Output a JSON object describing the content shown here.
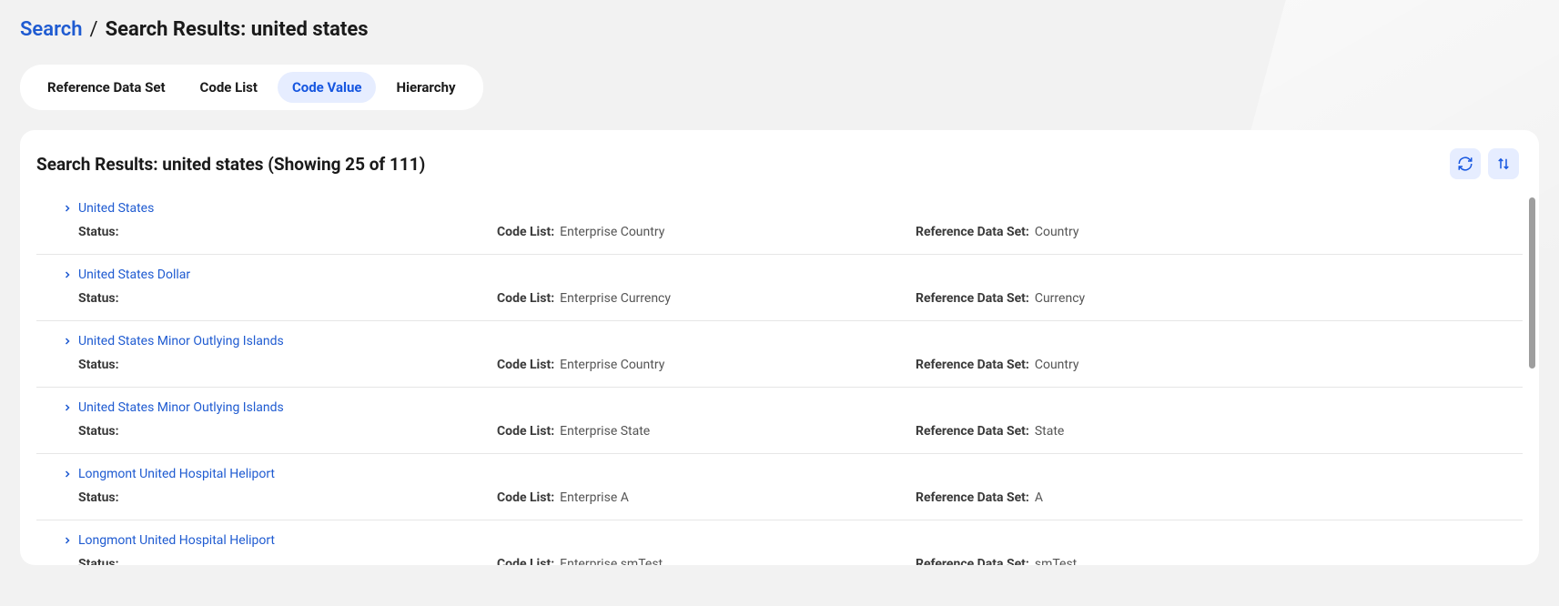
{
  "breadcrumb": {
    "root": "Search",
    "separator": "/",
    "current": "Search Results: united states"
  },
  "tabs": [
    {
      "label": "Reference Data Set",
      "active": false
    },
    {
      "label": "Code List",
      "active": false
    },
    {
      "label": "Code Value",
      "active": true
    },
    {
      "label": "Hierarchy",
      "active": false
    }
  ],
  "panel": {
    "title": "Search Results: united states (Showing 25 of 111)",
    "labels": {
      "status": "Status:",
      "codeList": "Code List:",
      "refDataSet": "Reference Data Set:"
    }
  },
  "results": [
    {
      "name": "United States",
      "status": "",
      "codeList": "Enterprise Country",
      "refDataSet": "Country"
    },
    {
      "name": "United States Dollar",
      "status": "",
      "codeList": "Enterprise Currency",
      "refDataSet": "Currency"
    },
    {
      "name": "United States Minor Outlying Islands",
      "status": "",
      "codeList": "Enterprise Country",
      "refDataSet": "Country"
    },
    {
      "name": "United States Minor Outlying Islands",
      "status": "",
      "codeList": "Enterprise State",
      "refDataSet": "State"
    },
    {
      "name": "Longmont United Hospital Heliport",
      "status": "",
      "codeList": "Enterprise A",
      "refDataSet": "A"
    },
    {
      "name": "Longmont United Hospital Heliport",
      "status": "",
      "codeList": "Enterprise smTest",
      "refDataSet": "smTest"
    }
  ]
}
